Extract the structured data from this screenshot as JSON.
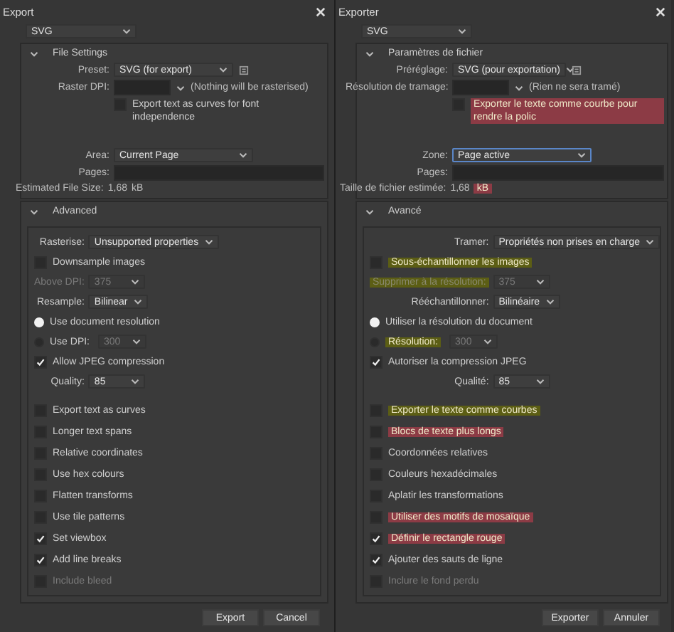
{
  "dialogs": [
    {
      "title": "Export",
      "format": "SVG",
      "file_settings": {
        "header": "File Settings",
        "preset": {
          "label": "Preset:",
          "value": "SVG (for export)"
        },
        "raster_dpi": {
          "label": "Raster DPI:",
          "note": "(Nothing will be rasterised)"
        },
        "text_curves": {
          "label": "Export text as curves for font independence",
          "checked": false
        },
        "area": {
          "label": "Area:",
          "value": "Current Page",
          "focused": false
        },
        "pages": {
          "label": "Pages:"
        },
        "file_size": {
          "label": "Estimated File Size:",
          "value": "1,68",
          "unit": {
            "text": "kB"
          }
        }
      },
      "advanced": {
        "header": "Advanced",
        "image_rows": [
          {
            "kind": "select",
            "label": "Rasterise:",
            "value": "Unsupported properties",
            "disabled": false
          },
          {
            "kind": "checkbox",
            "label": "Downsample images",
            "checked": false,
            "disabled": false
          },
          {
            "kind": "select",
            "label": "Above DPI:",
            "value": "375",
            "disabled": true
          },
          {
            "kind": "select",
            "label": "Resample:",
            "value": "Bilinear",
            "disabled": false
          },
          {
            "kind": "radio",
            "label": "Use document resolution",
            "selected": true
          },
          {
            "kind": "radio",
            "label": "Use DPI:",
            "selected": false,
            "value": "300"
          },
          {
            "kind": "checkbox",
            "label": "Allow JPEG compression",
            "checked": true,
            "disabled": false
          },
          {
            "kind": "select",
            "label": "Quality:",
            "value": "85",
            "disabled": false
          }
        ],
        "options": [
          {
            "label": "Export text as curves",
            "checked": false,
            "disabled": false
          },
          {
            "label": "Longer text spans",
            "checked": false,
            "disabled": false
          },
          {
            "label": "Relative coordinates",
            "checked": false,
            "disabled": false
          },
          {
            "label": "Use hex colours",
            "checked": false,
            "disabled": false
          },
          {
            "label": "Flatten transforms",
            "checked": false,
            "disabled": false
          },
          {
            "label": "Use tile patterns",
            "checked": false,
            "disabled": false
          },
          {
            "label": "Set viewbox",
            "checked": true,
            "disabled": false
          },
          {
            "label": "Add line breaks",
            "checked": true,
            "disabled": false
          },
          {
            "label": "Include bleed",
            "checked": false,
            "disabled": true
          }
        ]
      },
      "buttons": [
        "Export",
        "Cancel"
      ]
    },
    {
      "title": "Exporter",
      "format": "SVG",
      "file_settings": {
        "header": "Paramètres de fichier",
        "preset": {
          "label": "Préréglage:",
          "value": "SVG (pour exportation)"
        },
        "raster_dpi": {
          "label": "Résolution de tramage:",
          "note": "(Rien ne sera tramé)"
        },
        "text_curves": {
          "label": "Exporter le texte comme courbe pour rendre la polic",
          "checked": false,
          "color": "#8c3b45"
        },
        "area": {
          "label": "Zone:",
          "value": "Page active",
          "focused": true
        },
        "pages": {
          "label": "Pages:"
        },
        "file_size": {
          "label": "Taille de fichier estimée:",
          "value": "1,68",
          "unit": {
            "text": "kB",
            "color": "#8c3b45"
          }
        }
      },
      "advanced": {
        "header": "Avancé",
        "image_rows": [
          {
            "kind": "select",
            "label": "Tramer:",
            "value": "Propriétés non prises en charge",
            "disabled": false
          },
          {
            "kind": "checkbox",
            "label": "Sous-échantillonner les images",
            "checked": false,
            "disabled": false,
            "color": "#5c5e14"
          },
          {
            "kind": "select",
            "label": "Supprimer à la résolution:",
            "value": "375",
            "disabled": true,
            "color": "#5c5e14"
          },
          {
            "kind": "select",
            "label": "Rééchantillonner:",
            "value": "Bilinéaire",
            "disabled": false
          },
          {
            "kind": "radio",
            "label": "Utiliser la résolution du document",
            "selected": true
          },
          {
            "kind": "radio",
            "label": "Résolution:",
            "selected": false,
            "value": "300",
            "color": "#5c5e14"
          },
          {
            "kind": "checkbox",
            "label": "Autoriser la compression JPEG",
            "checked": true,
            "disabled": false
          },
          {
            "kind": "select",
            "label": "Qualité:",
            "value": "85",
            "disabled": false
          }
        ],
        "options": [
          {
            "label": "Exporter le texte comme courbes",
            "checked": false,
            "disabled": false,
            "color": "#5c5e14"
          },
          {
            "label": "Blocs de texte plus longs",
            "checked": false,
            "disabled": false,
            "color": "#8c3b45"
          },
          {
            "label": "Coordonnées relatives",
            "checked": false,
            "disabled": false
          },
          {
            "label": "Couleurs hexadécimales",
            "checked": false,
            "disabled": false
          },
          {
            "label": "Aplatir les transformations",
            "checked": false,
            "disabled": false
          },
          {
            "label": "Utiliser des motifs de mosaïque",
            "checked": false,
            "disabled": false,
            "color": "#8c3b45"
          },
          {
            "label": "Définir le rectangle rouge",
            "checked": true,
            "disabled": false,
            "color": "#8c3b45"
          },
          {
            "label": "Ajouter des sauts de ligne",
            "checked": true,
            "disabled": false
          },
          {
            "label": "Inclure le fond perdu",
            "checked": false,
            "disabled": true
          }
        ]
      },
      "buttons": [
        "Exporter",
        "Annuler"
      ]
    }
  ]
}
